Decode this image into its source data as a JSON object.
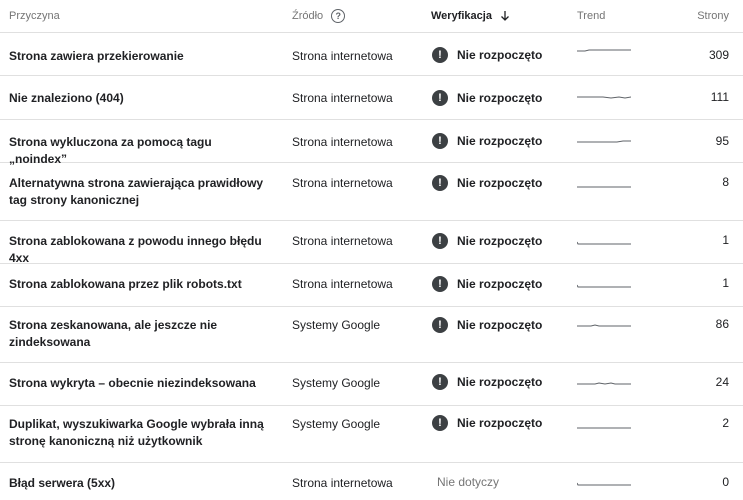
{
  "header": {
    "reason": "Przyczyna",
    "source": "Źródło",
    "verification": "Weryfikacja",
    "trend": "Trend",
    "pages": "Strony"
  },
  "rows": [
    {
      "reason": "Strona zawiera przekierowanie",
      "source": "Strona internetowa",
      "verification": "Nie rozpoczęto",
      "pages": "309"
    },
    {
      "reason": "Nie znaleziono (404)",
      "source": "Strona internetowa",
      "verification": "Nie rozpoczęto",
      "pages": "111"
    },
    {
      "reason": "Strona wykluczona za pomocą tagu „noindex”",
      "source": "Strona internetowa",
      "verification": "Nie rozpoczęto",
      "pages": "95"
    },
    {
      "reason": "Alternatywna strona zawierająca prawidłowy tag strony kanonicznej",
      "source": "Strona internetowa",
      "verification": "Nie rozpoczęto",
      "pages": "8"
    },
    {
      "reason": "Strona zablokowana z powodu innego błędu 4xx",
      "source": "Strona internetowa",
      "verification": "Nie rozpoczęto",
      "pages": "1"
    },
    {
      "reason": "Strona zablokowana przez plik robots.txt",
      "source": "Strona internetowa",
      "verification": "Nie rozpoczęto",
      "pages": "1"
    },
    {
      "reason": "Strona zeskanowana, ale jeszcze nie zindeksowana",
      "source": "Systemy Google",
      "verification": "Nie rozpoczęto",
      "pages": "86"
    },
    {
      "reason": "Strona wykryta – obecnie niezindeksowana",
      "source": "Systemy Google",
      "verification": "Nie rozpoczęto",
      "pages": "24"
    },
    {
      "reason": "Duplikat, wyszukiwarka Google wybrała inną stronę kanoniczną niż użytkownik",
      "source": "Systemy Google",
      "verification": "Nie rozpoczęto",
      "pages": "2"
    },
    {
      "reason": "Błąd serwera (5xx)",
      "source": "Strona internetowa",
      "verification": "Nie dotyczy",
      "pages": "0"
    }
  ],
  "icons": {
    "help": "help-circle-icon",
    "sort": "arrow-down-icon",
    "warning": "exclamation-circle-icon"
  },
  "colors": {
    "text": "#202124",
    "muted": "#757575",
    "divider": "#e0e0e0",
    "warning_icon": "#3c4043"
  }
}
